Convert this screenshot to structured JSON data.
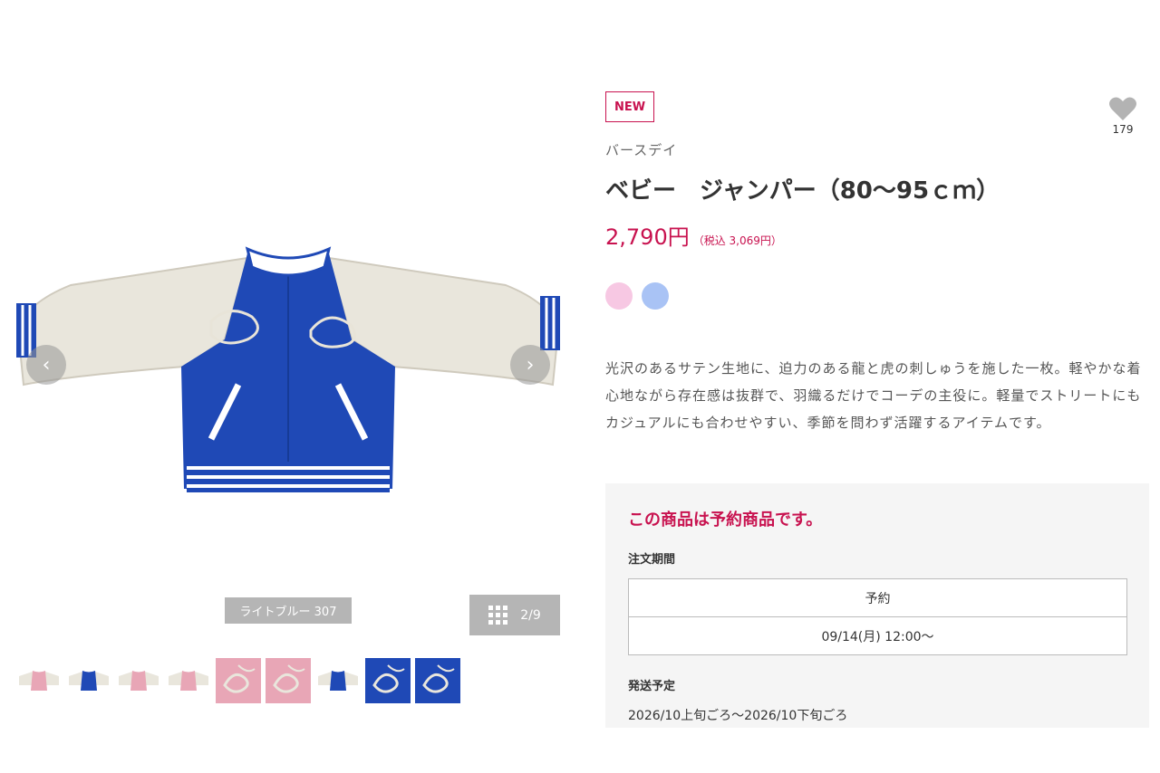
{
  "gallery": {
    "color_caption": "ライトブルー 307",
    "counter": "2/9",
    "prev_arrow": "‹",
    "next_arrow": "›",
    "thumbnails": [
      {
        "variant": "pink-front",
        "color": "#e8a6b6"
      },
      {
        "variant": "blue-front",
        "color": "#1f49b6"
      },
      {
        "variant": "pink-front",
        "color": "#e8a6b6"
      },
      {
        "variant": "pink-front",
        "color": "#e8a6b6"
      },
      {
        "variant": "pink-detail",
        "color": "#e8a6b6"
      },
      {
        "variant": "pink-detail",
        "color": "#e8a6b6"
      },
      {
        "variant": "blue-front",
        "color": "#1f49b6"
      },
      {
        "variant": "blue-detail",
        "color": "#1f49b6"
      },
      {
        "variant": "blue-detail",
        "color": "#1f49b6"
      }
    ]
  },
  "product": {
    "badge": "NEW",
    "brand": "バースデイ",
    "title": "ベビー　ジャンパー（80〜95ｃｍ）",
    "price": "2,790円",
    "price_tax": "（税込 3,069円）",
    "favorite_count": "179",
    "swatches": [
      {
        "name": "pink",
        "color": "#f7c8e3"
      },
      {
        "name": "light-blue",
        "color": "#a9c3f5"
      }
    ],
    "description": "光沢のあるサテン生地に、迫力のある龍と虎の刺しゅうを施した一枚。軽やかな着心地ながら存在感は抜群で、羽織るだけでコーデの主役に。軽量でストリートにもカジュアルにも合わせやすい、季節を問わず活躍するアイテムです。"
  },
  "reservation": {
    "title": "この商品は予約商品です。",
    "order_period_label": "注文期間",
    "order_type": "予約",
    "order_period": "09/14(月) 12:00〜",
    "shipping_label": "発送予定",
    "shipping_value": "2026/10上旬ごろ〜2026/10下旬ごろ"
  },
  "colors": {
    "accent": "#c8124f",
    "jacket_body": "#1f49b6",
    "jacket_sleeve": "#e9e6dc",
    "button_gray": "#b5b5b5"
  }
}
